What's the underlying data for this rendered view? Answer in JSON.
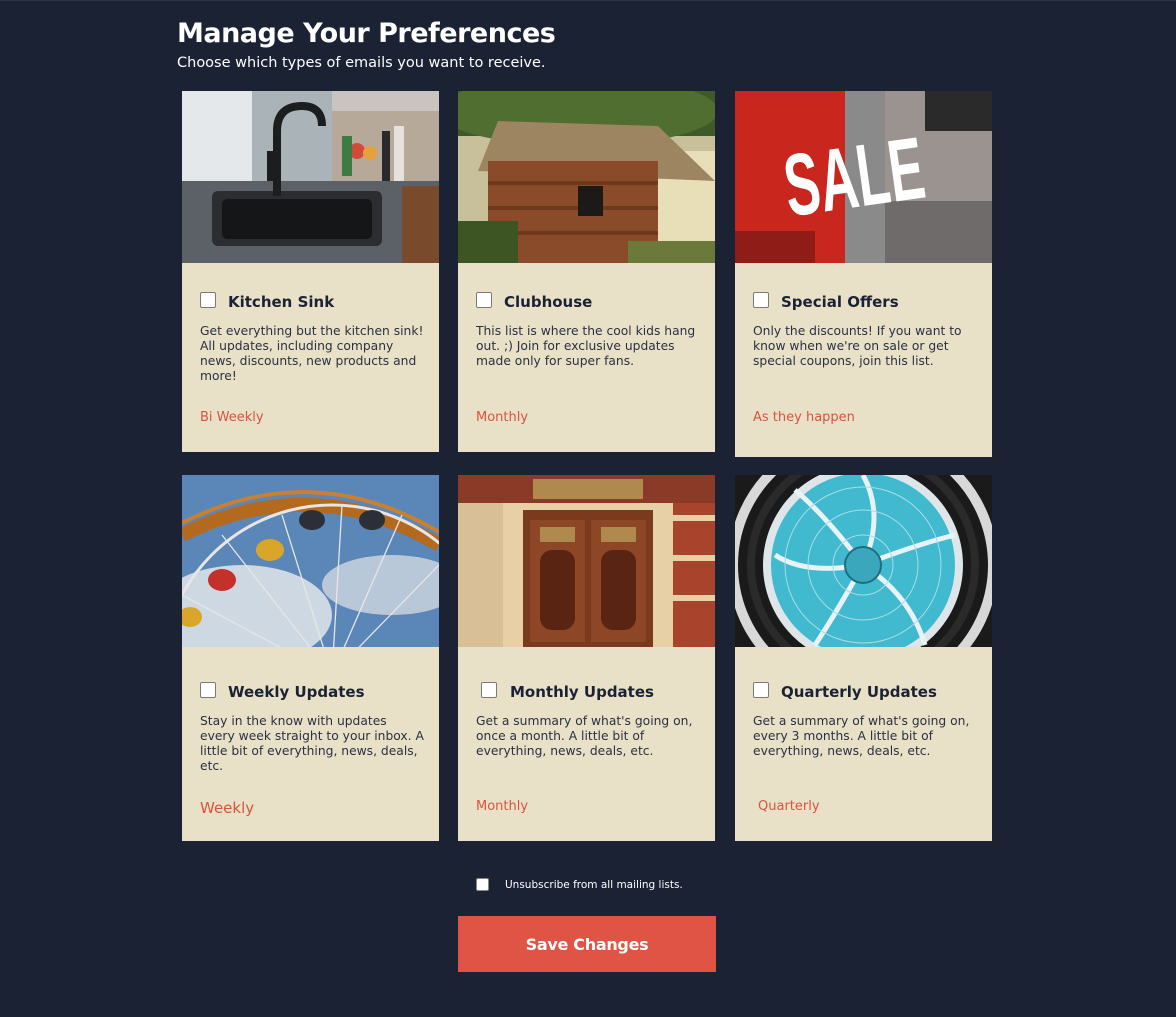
{
  "header": {
    "title": "Manage Your Preferences",
    "subtitle": "Choose which types of emails you want to receive."
  },
  "lists": [
    {
      "title": "Kitchen Sink",
      "description": "Get everything but the kitchen sink! All updates, including company news, discounts, new products and more!",
      "frequency": "Bi Weekly",
      "checked": false,
      "image": "kitchen-sink-photo"
    },
    {
      "title": "Clubhouse",
      "description": "This list is where the cool kids hang out. ;) Join for exclusive updates made only for super fans.",
      "frequency": "Monthly",
      "checked": false,
      "image": "wooden-clubhouse-photo"
    },
    {
      "title": "Special Offers",
      "description": "Only the discounts! If you want to know when we're on sale or get special coupons, join this list.",
      "frequency": "As they happen",
      "checked": false,
      "image": "sale-window-photo"
    },
    {
      "title": "Weekly Updates",
      "description": "Stay in the know with updates every week straight to your inbox. A little bit of everything, news, deals, etc.",
      "frequency": "Weekly",
      "checked": false,
      "image": "ferris-wheel-photo"
    },
    {
      "title": "Monthly Updates",
      "description": "Get a summary of what's going on, once a month. A little bit of everything, news, deals, etc.",
      "frequency": "Monthly",
      "checked": false,
      "image": "ornate-door-photo"
    },
    {
      "title": "Quarterly Updates",
      "description": "Get a summary of what's going on, every 3 months. A little bit of everything, news, deals, etc.",
      "frequency": "Quarterly",
      "checked": false,
      "image": "glass-dome-photo"
    }
  ],
  "unsubscribe": {
    "label": "Unsubscribe from all mailing lists.",
    "checked": false
  },
  "save_button": {
    "label": "Save Changes"
  },
  "colors": {
    "background": "#1a2234",
    "card": "#e8e1c8",
    "accent": "#df5444",
    "frequency_text": "#d9533f"
  }
}
